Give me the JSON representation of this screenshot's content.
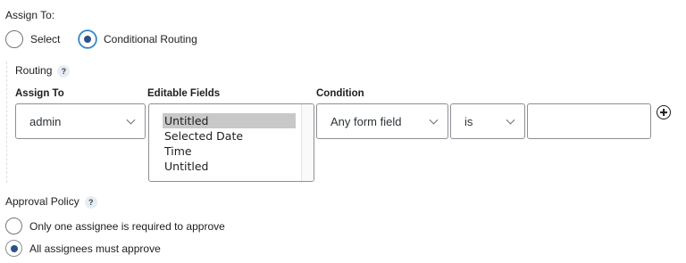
{
  "assign_to": {
    "label": "Assign To:",
    "options": [
      {
        "label": "Select",
        "checked": false
      },
      {
        "label": "Conditional Routing",
        "checked": true
      }
    ]
  },
  "routing": {
    "label": "Routing",
    "help": "?",
    "columns": {
      "assign_to": "Assign To",
      "editable_fields": "Editable Fields",
      "condition": "Condition"
    },
    "assignee_value": "admin",
    "editable_fields": [
      "Untitled",
      "Selected Date",
      "Time",
      "Untitled"
    ],
    "selected_field_index": 0,
    "condition_field": "Any form field",
    "condition_operator": "is",
    "condition_value": ""
  },
  "approval_policy": {
    "label": "Approval Policy",
    "help": "?",
    "options": [
      {
        "label": "Only one assignee is required to approve",
        "checked": false
      },
      {
        "label": "All assignees must approve",
        "checked": true
      }
    ]
  },
  "icons": {
    "add_rule": "plus-circle-icon",
    "dropdown": "chevron-down-icon"
  },
  "colors": {
    "accent": "#2c5288",
    "border": "#8c8f94",
    "selected_option_bg": "#c8c8c8"
  }
}
